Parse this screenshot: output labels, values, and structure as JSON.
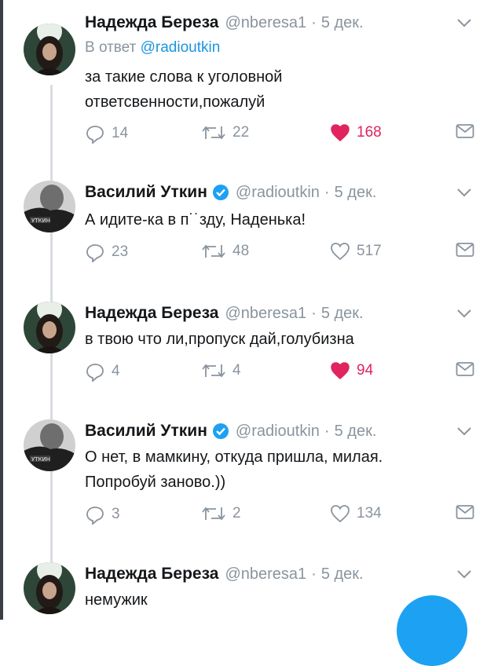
{
  "colors": {
    "accent": "#1da1f2",
    "like": "#e0245e",
    "muted": "#8a949e",
    "text": "#14171a"
  },
  "tweets": [
    {
      "name": "Надежда Береза",
      "handle": "@nberesa1",
      "separator": "·",
      "date": "5 дек.",
      "reply_prefix": "В ответ",
      "reply_mention": "@radioutkin",
      "lines": [
        "за такие слова к уголовной",
        "ответсвенности,пожалуй"
      ],
      "replies": "14",
      "retweets": "22",
      "likes": "168",
      "liked": true,
      "verified": false,
      "avatar": "woman-avatar"
    },
    {
      "name": "Василий Уткин",
      "handle": "@radioutkin",
      "separator": "·",
      "date": "5 дек.",
      "lines": [
        "А идите-ка в п˙˙зду, Наденька!"
      ],
      "replies": "23",
      "retweets": "48",
      "likes": "517",
      "liked": false,
      "verified": true,
      "avatar": "man-avatar"
    },
    {
      "name": "Надежда Береза",
      "handle": "@nberesa1",
      "separator": "·",
      "date": "5 дек.",
      "lines": [
        "в твою что ли,пропуск дай,голубизна"
      ],
      "replies": "4",
      "retweets": "4",
      "likes": "94",
      "liked": true,
      "verified": false,
      "avatar": "woman-avatar"
    },
    {
      "name": "Василий Уткин",
      "handle": "@radioutkin",
      "separator": "·",
      "date": "5 дек.",
      "lines": [
        "О нет, в мамкину, откуда пришла, милая.",
        "Попробуй заново.))"
      ],
      "replies": "3",
      "retweets": "2",
      "likes": "134",
      "liked": false,
      "verified": true,
      "avatar": "man-avatar"
    },
    {
      "name": "Надежда Береза",
      "handle": "@nberesa1",
      "separator": "·",
      "date": "5 дек.",
      "lines": [
        "немужик"
      ],
      "verified": false,
      "avatar": "woman-avatar"
    }
  ]
}
